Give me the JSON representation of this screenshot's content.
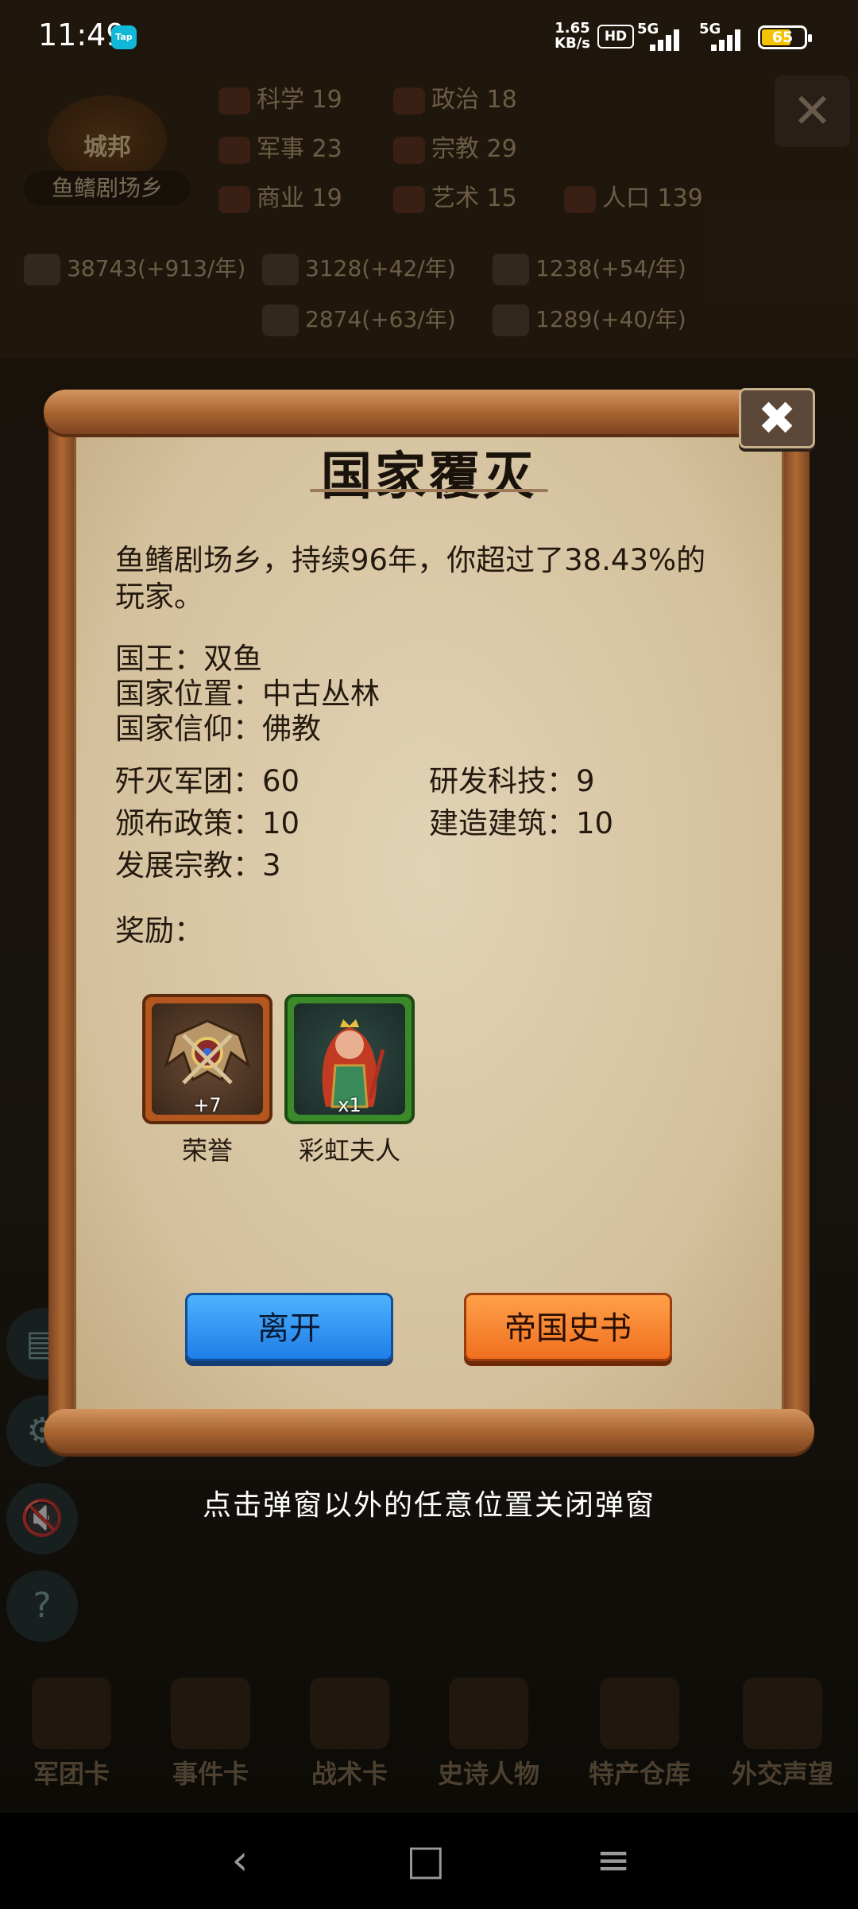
{
  "status_bar": {
    "time": "11:49",
    "tap_badge": "Tap",
    "speed_value": "1.65",
    "speed_unit": "KB/s",
    "hd": "HD",
    "net1": "5G",
    "net2": "5G",
    "battery": "65"
  },
  "background": {
    "city_badge": "城邦",
    "city_name": "鱼鳍剧场乡",
    "stats": [
      "科学 19",
      "政治 18",
      "军事 23",
      "宗教 29",
      "商业 19",
      "艺术 15",
      "人口 139"
    ],
    "resources": [
      "38743(+913/年)",
      "3128(+42/年)",
      "1238(+54/年)",
      "2874(+63/年)",
      "1289(+40/年)"
    ],
    "nav_items": [
      "军团卡",
      "事件卡",
      "战术卡",
      "史诗人物",
      "特产仓库",
      "外交声望"
    ]
  },
  "dialog": {
    "title": "国家覆灭",
    "summary": "鱼鳍剧场乡，持续96年，你超过了38.43%的玩家。",
    "king": "国王：双鱼",
    "location": "国家位置：中古丛林",
    "faith": "国家信仰：佛教",
    "stats": {
      "destroyed_legions": "歼灭军团：60",
      "researched_tech": "研发科技：9",
      "policies": "颁布政策：10",
      "buildings": "建造建筑：10",
      "religions": "发展宗教：3"
    },
    "rewards_label": "奖励：",
    "rewards": [
      {
        "name": "荣誉",
        "qty": "+7"
      },
      {
        "name": "彩虹夫人",
        "qty": "x1"
      }
    ],
    "leave_button": "离开",
    "history_button": "帝国史书",
    "close_icon": "✖"
  },
  "hint": "点击弹窗以外的任意位置关闭弹窗",
  "system_nav": {
    "back": "‹",
    "home": "□",
    "menu": "≡"
  },
  "colors": {
    "leave_button": "#2b8ff2",
    "history_button": "#f5822f",
    "parchment": "#dccba9"
  }
}
